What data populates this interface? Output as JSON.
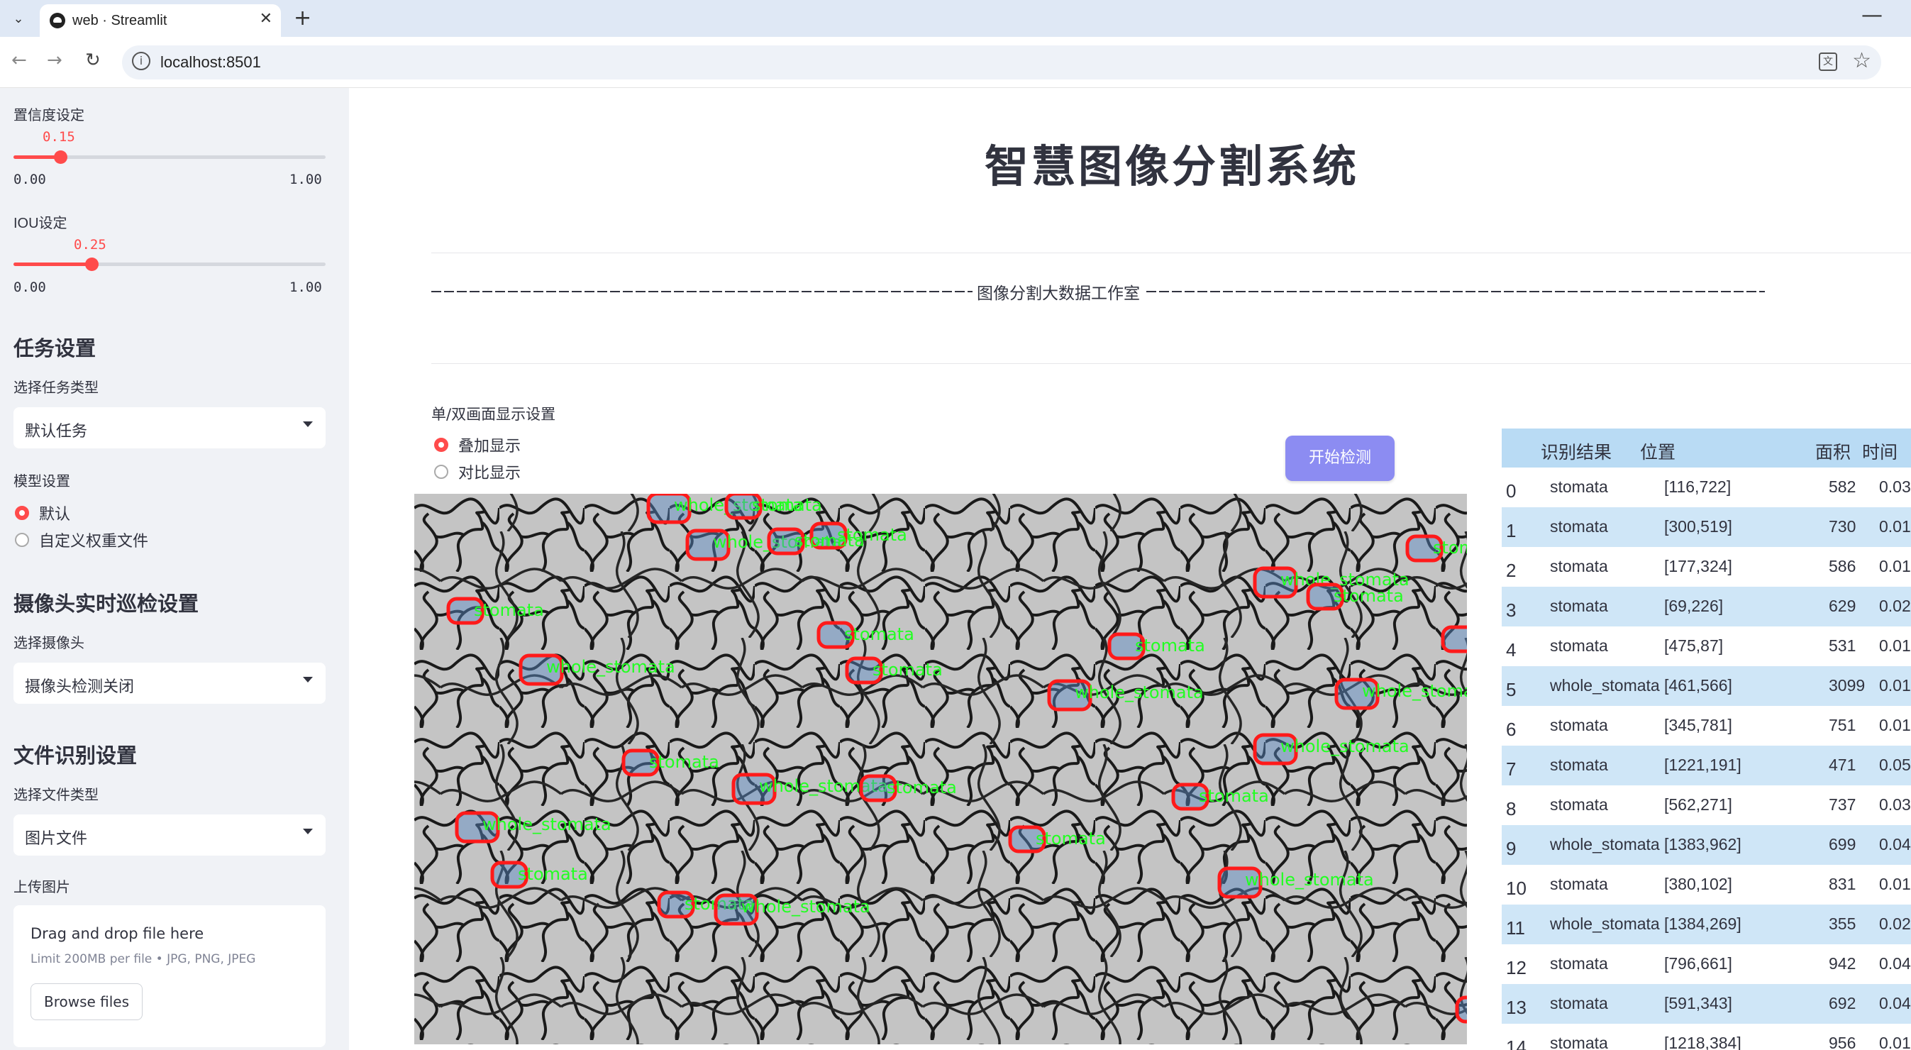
{
  "browser": {
    "tab_title": "web · Streamlit",
    "url": "localhost:8501"
  },
  "sidebar": {
    "confidence": {
      "label": "置信度设定",
      "value": "0.15",
      "min": "0.00",
      "max": "1.00",
      "fraction": 0.15
    },
    "iou": {
      "label": "IOU设定",
      "value": "0.25",
      "min": "0.00",
      "max": "1.00",
      "fraction": 0.25
    },
    "task_header": "任务设置",
    "task_type_label": "选择任务类型",
    "task_type_value": "默认任务",
    "model_label": "模型设置",
    "model_options": [
      "默认",
      "自定义权重文件"
    ],
    "model_selected": "默认",
    "camera_header": "摄像头实时巡检设置",
    "camera_label": "选择摄像头",
    "camera_value": "摄像头检测关闭",
    "file_header": "文件识别设置",
    "file_type_label": "选择文件类型",
    "file_type_value": "图片文件",
    "upload_label": "上传图片",
    "upload_title": "Drag and drop file here",
    "upload_limit": "Limit 200MB per file • JPG, PNG, JPEG",
    "upload_button": "Browse files"
  },
  "main": {
    "title": "智慧图像分割系统",
    "subtitle": "图像分割大数据工作室",
    "display_label": "单/双画面显示设置",
    "display_options": [
      "叠加显示",
      "对比显示"
    ],
    "display_selected": "叠加显示",
    "start_button": "开始检测"
  },
  "detections": {
    "columns": [
      "识别结果",
      "位置",
      "面积",
      "时间"
    ],
    "rows": [
      {
        "idx": "0",
        "label": "stomata",
        "pos": "[116,722]",
        "area": "582",
        "time": "0.03"
      },
      {
        "idx": "1",
        "label": "stomata",
        "pos": "[300,519]",
        "area": "730",
        "time": "0.01"
      },
      {
        "idx": "2",
        "label": "stomata",
        "pos": "[177,324]",
        "area": "586",
        "time": "0.01"
      },
      {
        "idx": "3",
        "label": "stomata",
        "pos": "[69,226]",
        "area": "629",
        "time": "0.02"
      },
      {
        "idx": "4",
        "label": "stomata",
        "pos": "[475,87]",
        "area": "531",
        "time": "0.01"
      },
      {
        "idx": "5",
        "label": "whole_stomata",
        "pos": "[461,566]",
        "area": "3099",
        "time": "0.01"
      },
      {
        "idx": "6",
        "label": "stomata",
        "pos": "[345,781]",
        "area": "751",
        "time": "0.01"
      },
      {
        "idx": "7",
        "label": "stomata",
        "pos": "[1221,191]",
        "area": "471",
        "time": "0.05"
      },
      {
        "idx": "8",
        "label": "stomata",
        "pos": "[562,271]",
        "area": "737",
        "time": "0.03"
      },
      {
        "idx": "9",
        "label": "whole_stomata",
        "pos": "[1383,962]",
        "area": "699",
        "time": "0.04"
      },
      {
        "idx": "10",
        "label": "stomata",
        "pos": "[380,102]",
        "area": "831",
        "time": "0.01"
      },
      {
        "idx": "11",
        "label": "whole_stomata",
        "pos": "[1384,269]",
        "area": "355",
        "time": "0.02"
      },
      {
        "idx": "12",
        "label": "stomata",
        "pos": "[796,661]",
        "area": "942",
        "time": "0.04"
      },
      {
        "idx": "13",
        "label": "stomata",
        "pos": "[591,343]",
        "area": "692",
        "time": "0.04"
      },
      {
        "idx": "14",
        "label": "stomata",
        "pos": "[1218,384]",
        "area": "956",
        "time": "0.01"
      }
    ]
  },
  "overlay_labels": [
    "whole_stomata",
    "stomata"
  ],
  "colors": {
    "accent": "#ff4b4b",
    "button": "#8c8cf2",
    "table_header": "#b9dbf4",
    "table_alt_row": "#cfe6f7",
    "box": "#ff1a1a",
    "label": "#22ff22"
  }
}
